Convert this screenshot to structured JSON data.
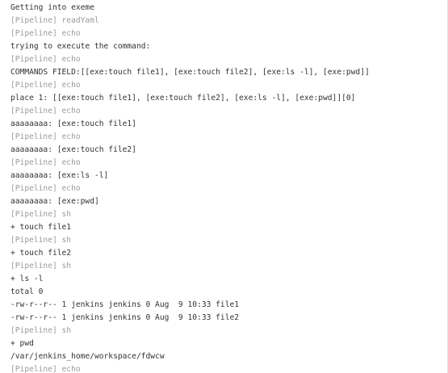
{
  "console": {
    "lines": [
      {
        "text": "Getting into exeme",
        "kind": "output"
      },
      {
        "text": "[Pipeline] readYaml",
        "kind": "pipeline"
      },
      {
        "text": "[Pipeline] echo",
        "kind": "pipeline"
      },
      {
        "text": "trying to execute the command:",
        "kind": "output"
      },
      {
        "text": "[Pipeline] echo",
        "kind": "pipeline"
      },
      {
        "text": "COMMANDS FIELD:[[exe:touch file1], [exe:touch file2], [exe:ls -l], [exe:pwd]]",
        "kind": "output"
      },
      {
        "text": "[Pipeline] echo",
        "kind": "pipeline"
      },
      {
        "text": "place 1: [[exe:touch file1], [exe:touch file2], [exe:ls -l], [exe:pwd]][0]",
        "kind": "output"
      },
      {
        "text": "[Pipeline] echo",
        "kind": "pipeline"
      },
      {
        "text": "aaaaaaaa: [exe:touch file1]",
        "kind": "output"
      },
      {
        "text": "[Pipeline] echo",
        "kind": "pipeline"
      },
      {
        "text": "aaaaaaaa: [exe:touch file2]",
        "kind": "output"
      },
      {
        "text": "[Pipeline] echo",
        "kind": "pipeline"
      },
      {
        "text": "aaaaaaaa: [exe:ls -l]",
        "kind": "output"
      },
      {
        "text": "[Pipeline] echo",
        "kind": "pipeline"
      },
      {
        "text": "aaaaaaaa: [exe:pwd]",
        "kind": "output"
      },
      {
        "text": "[Pipeline] sh",
        "kind": "pipeline"
      },
      {
        "text": "+ touch file1",
        "kind": "output"
      },
      {
        "text": "[Pipeline] sh",
        "kind": "pipeline"
      },
      {
        "text": "+ touch file2",
        "kind": "output"
      },
      {
        "text": "[Pipeline] sh",
        "kind": "pipeline"
      },
      {
        "text": "+ ls -l",
        "kind": "output"
      },
      {
        "text": "total 0",
        "kind": "output"
      },
      {
        "text": "-rw-r--r-- 1 jenkins jenkins 0 Aug  9 10:33 file1",
        "kind": "output"
      },
      {
        "text": "-rw-r--r-- 1 jenkins jenkins 0 Aug  9 10:33 file2",
        "kind": "output"
      },
      {
        "text": "[Pipeline] sh",
        "kind": "pipeline"
      },
      {
        "text": "+ pwd",
        "kind": "output"
      },
      {
        "text": "/var/jenkins_home/workspace/fdwcw",
        "kind": "output"
      },
      {
        "text": "[Pipeline] echo",
        "kind": "pipeline"
      }
    ]
  }
}
